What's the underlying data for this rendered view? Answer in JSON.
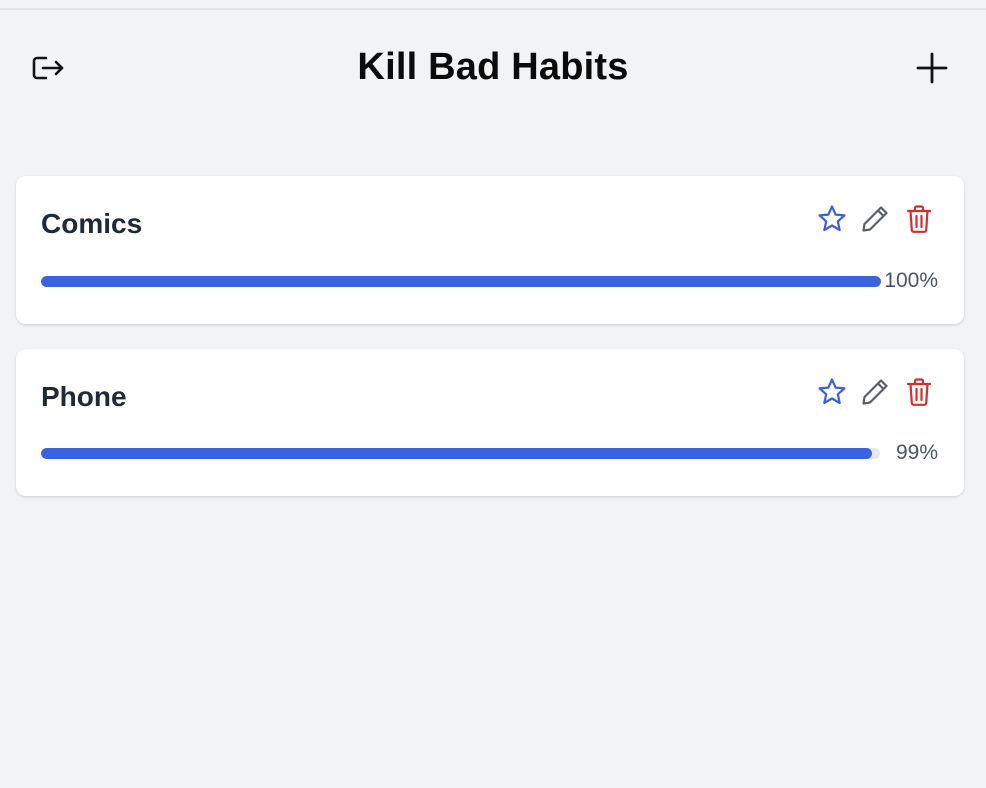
{
  "header": {
    "title": "Kill Bad Habits",
    "logout_icon": "logout-icon",
    "add_icon": "plus-icon"
  },
  "habits": [
    {
      "name": "Comics",
      "progress": 1.0,
      "progress_label": "100%"
    },
    {
      "name": "Phone",
      "progress": 0.99,
      "progress_label": "99%"
    }
  ],
  "icons": {
    "favorite": "star-icon",
    "edit": "pencil-icon",
    "delete": "trash-icon"
  },
  "colors": {
    "accent": "#3a63e0",
    "star": "#3b5ee6",
    "pencil": "#5b5f66",
    "trash": "#d32f2f",
    "background": "#f2f3f5"
  }
}
